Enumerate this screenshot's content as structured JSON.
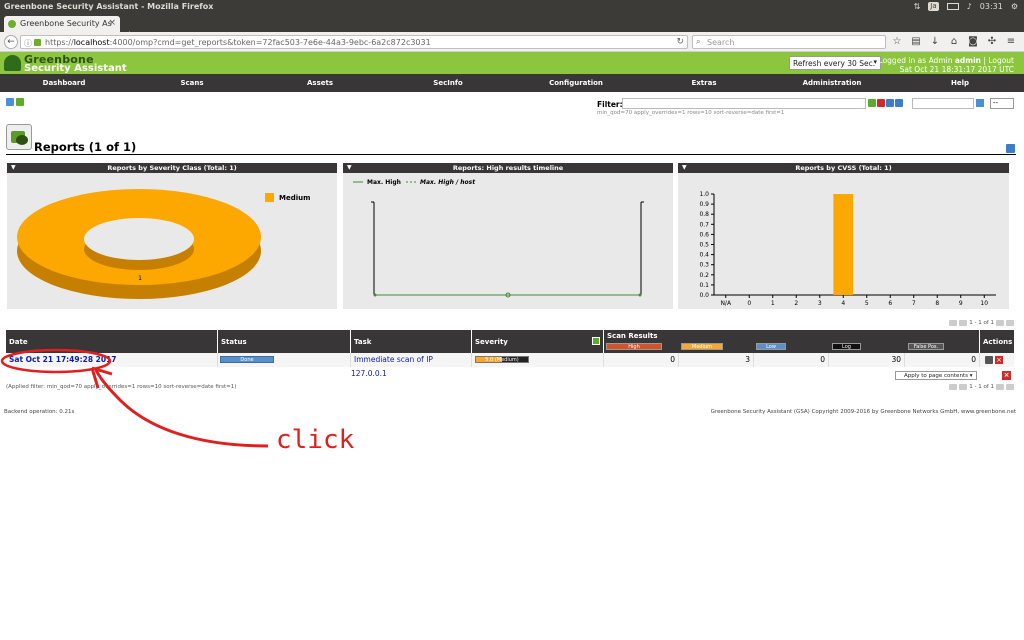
{
  "os": {
    "window_title": "Greenbone Security Assistant - Mozilla Firefox",
    "keyboard_layout": "Ja",
    "clock": "03:31"
  },
  "browser": {
    "tab_title": "Greenbone Security As",
    "url_prefix": "https://",
    "url_host": "localhost",
    "url_rest": ":4000/omp?cmd=get_reports&token=72fac503-7e6e-44a3-9ebc-6a2c872c3031",
    "search_placeholder": "Search",
    "new_tab": "+",
    "close_tab": "×"
  },
  "gsa": {
    "logo_line1": "Greenbone",
    "logo_line2": "Security Assistant",
    "refresh_select": "Refresh every 30 Sec.",
    "logged_in_as": "Logged in as",
    "role": "Admin",
    "user": "admin",
    "logout": "Logout",
    "datetime": "Sat Oct 21 18:31:17 2017 UTC",
    "menu": [
      "Dashboard",
      "Scans",
      "Assets",
      "SecInfo",
      "Configuration",
      "Extras",
      "Administration",
      "Help"
    ]
  },
  "filter": {
    "label": "Filter:",
    "value": "",
    "text": "min_qod=70 apply_overrides=1 rows=10 sort-reverse=date first=1",
    "select_value": "--"
  },
  "page": {
    "title": "Reports (1 of 1)"
  },
  "charts": {
    "severity_title": "Reports by Severity Class (Total: 1)",
    "timeline_title": "Reports: High results timeline",
    "cvss_title": "Reports by CVSS (Total: 1)",
    "legend_max_high": "Max. High",
    "legend_max_high_host": "Max. High / host",
    "colors": {
      "medium": "#fca800",
      "medium_dark": "#c77f00",
      "high_line": "#3d8b3d"
    }
  },
  "chart_data": [
    {
      "type": "pie",
      "title": "Reports by Severity Class (Total: 1)",
      "categories": [
        "Medium"
      ],
      "values": [
        1
      ],
      "legend": "top-right"
    },
    {
      "type": "line",
      "title": "Reports: High results timeline",
      "series": [
        {
          "name": "Max. High",
          "values": [
            0
          ]
        },
        {
          "name": "Max. High / host",
          "values": [
            0
          ]
        }
      ]
    },
    {
      "type": "bar",
      "title": "Reports by CVSS (Total: 1)",
      "categories": [
        "N/A",
        "0",
        "1",
        "2",
        "3",
        "4",
        "5",
        "6",
        "7",
        "8",
        "9",
        "10"
      ],
      "values": [
        0,
        0,
        0,
        0,
        0,
        1,
        0,
        0,
        0,
        0,
        0,
        0
      ],
      "yticks": [
        "0.0",
        "0.1",
        "0.2",
        "0.3",
        "0.4",
        "0.5",
        "0.6",
        "0.7",
        "0.8",
        "0.9",
        "1.0"
      ],
      "ylim": [
        0,
        1
      ]
    }
  ],
  "table": {
    "headers": {
      "date": "Date",
      "status": "Status",
      "task": "Task",
      "severity": "Severity",
      "scan_results": "Scan Results",
      "actions": "Actions"
    },
    "scan_result_columns": [
      "High",
      "Medium",
      "Low",
      "Log",
      "False Pos."
    ],
    "rows": [
      {
        "date": "Sat Oct 21 17:49:28 2017",
        "status": "Done",
        "task": "Immediate scan of IP 127.0.0.1",
        "severity": "5.0 (Medium)",
        "severity_fraction": 0.5,
        "high": "0",
        "medium": "3",
        "low": "0",
        "log": "30",
        "false_pos": "0"
      }
    ],
    "pager_text": "1 - 1 of 1",
    "apply_select": "Apply to page contents",
    "applied_filter": "(Applied filter: min_qod=70 apply_overrides=1 rows=10 sort-reverse=date first=1)"
  },
  "footer": {
    "backend": "Backend operation: 0.21s",
    "copyright": "Greenbone Security Assistant (GSA) Copyright 2009-2016 by Greenbone Networks GmbH, www.greenbone.net"
  },
  "annotation": {
    "text": "click",
    "color": "#e02020"
  }
}
